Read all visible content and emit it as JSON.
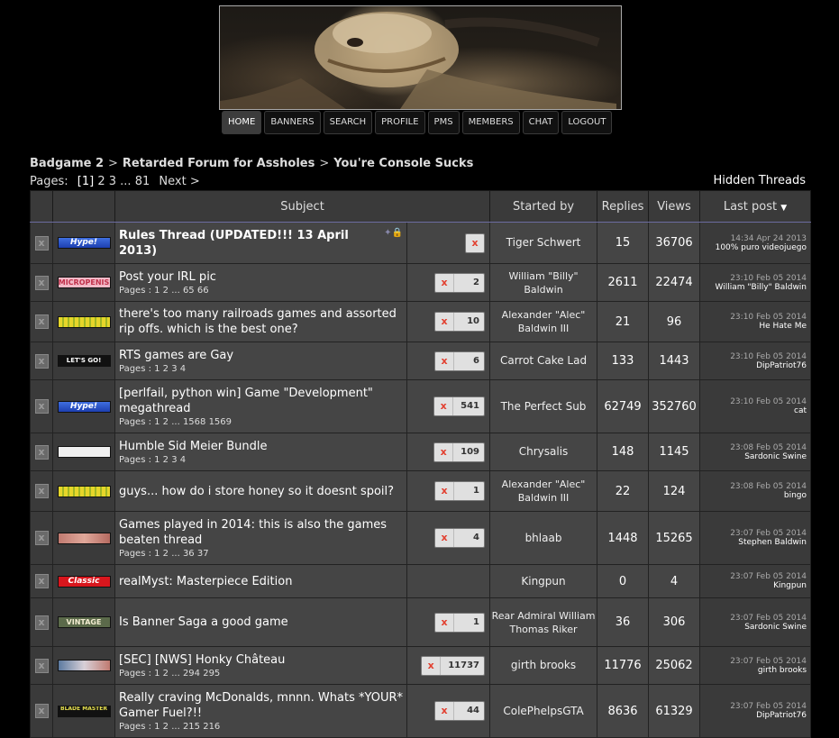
{
  "nav": {
    "items": [
      "Home",
      "Banners",
      "Search",
      "Profile",
      "PMs",
      "Members",
      "Chat",
      "Logout"
    ]
  },
  "breadcrumb": [
    "Badgame 2",
    "Retarded Forum for Assholes",
    "You're Console Sucks"
  ],
  "pages": {
    "label": "Pages:",
    "current": "[1]",
    "list": [
      "2",
      "3",
      "...",
      "81"
    ],
    "next": "Next >"
  },
  "hidden_threads": "Hidden Threads",
  "headers": {
    "subject": "Subject",
    "started_by": "Started by",
    "replies": "Replies",
    "views": "Views",
    "last_post": "Last post"
  },
  "threads": [
    {
      "icon": "Hype!",
      "icon_style": "hype",
      "title": "Rules Thread (UPDATED!!! 13 April 2013)",
      "bold": true,
      "pages": "",
      "unread": "",
      "author": "Tiger Schwert",
      "replies": "15",
      "views": "36706",
      "lp_time": "14:34 Apr 24 2013",
      "lp_user": "100% puro videojuego",
      "sticky": true
    },
    {
      "icon": "MICROPENIS",
      "icon_style": "pink",
      "title": "Post your IRL pic",
      "pages": "Pages : 1 2 ... 65 66",
      "unread": "2",
      "author": "William \"Billy\" Baldwin",
      "replies": "2611",
      "views": "22474",
      "lp_time": "23:10 Feb 05 2014",
      "lp_user": "William \"Billy\" Baldwin"
    },
    {
      "icon": "",
      "icon_style": "corn",
      "title": "there's too many railroads games and assorted rip offs. which is the best one?",
      "pages": "",
      "unread": "10",
      "author": "Alexander \"Alec\" Baldwin III",
      "replies": "21",
      "views": "96",
      "lp_time": "23:10 Feb 05 2014",
      "lp_user": "He Hate Me"
    },
    {
      "icon": "LET'S GO!",
      "icon_style": "letsgo",
      "title": "RTS games are Gay",
      "pages": "Pages : 1 2 3 4",
      "unread": "6",
      "author": "Carrot Cake Lad",
      "replies": "133",
      "views": "1443",
      "lp_time": "23:10 Feb 05 2014",
      "lp_user": "DipPatriot76"
    },
    {
      "icon": "Hype!",
      "icon_style": "hype",
      "title": "[perlfail, python win] Game \"Development\" megathread",
      "pages": "Pages : 1 2 ... 1568 1569",
      "unread": "541",
      "author": "The Perfect Sub",
      "replies": "62749",
      "views": "352760",
      "lp_time": "23:10 Feb 05 2014",
      "lp_user": "cat"
    },
    {
      "icon": "",
      "icon_style": "steam",
      "title": "Humble Sid Meier Bundle",
      "pages": "Pages : 1 2 3 4",
      "unread": "109",
      "author": "Chrysalis",
      "replies": "148",
      "views": "1145",
      "lp_time": "23:08 Feb 05 2014",
      "lp_user": "Sardonic Swine"
    },
    {
      "icon": "",
      "icon_style": "corn",
      "title": "guys... how do i store honey so it doesnt spoil?",
      "pages": "",
      "unread": "1",
      "author": "Alexander \"Alec\" Baldwin III",
      "replies": "22",
      "views": "124",
      "lp_time": "23:08 Feb 05 2014",
      "lp_user": "bingo"
    },
    {
      "icon": "",
      "icon_style": "face",
      "title": "Games played in 2014: this is also the games beaten thread",
      "pages": "Pages : 1 2 ... 36 37",
      "unread": "4",
      "author": "bhlaab",
      "replies": "1448",
      "views": "15265",
      "lp_time": "23:07 Feb 05 2014",
      "lp_user": "Stephen Baldwin"
    },
    {
      "icon": "Classic",
      "icon_style": "classic",
      "title": "realMyst: Masterpiece Edition",
      "pages": "",
      "unread": "",
      "author": "Kingpun",
      "replies": "0",
      "views": "4",
      "lp_time": "23:07 Feb 05 2014",
      "lp_user": "Kingpun"
    },
    {
      "icon": "VINTAGE",
      "icon_style": "vintage",
      "title": "Is Banner Saga a good game",
      "pages": "",
      "unread": "1",
      "author": "Rear Admiral William Thomas Riker",
      "replies": "36",
      "views": "306",
      "lp_time": "23:07 Feb 05 2014",
      "lp_user": "Sardonic Swine"
    },
    {
      "icon": "",
      "icon_style": "face2",
      "title": "[SEC] [NWS] Honky Château",
      "pages": "Pages : 1 2 ... 294 295",
      "unread": "11737",
      "author": "girth brooks",
      "replies": "11776",
      "views": "25062",
      "lp_time": "23:07 Feb 05 2014",
      "lp_user": "girth brooks"
    },
    {
      "icon": "BLADE MASTER",
      "icon_style": "blade",
      "title": "Really craving McDonalds, mnnn. Whats *YOUR* Gamer Fuel?!!",
      "pages": "Pages : 1 2 ... 215 216",
      "unread": "44",
      "author": "ColePhelpsGTA",
      "replies": "8636",
      "views": "61329",
      "lp_time": "23:07 Feb 05 2014",
      "lp_user": "DipPatriot76"
    }
  ],
  "colors": {
    "background": "#000000",
    "row": "#454545",
    "header": "#3a3a3a",
    "unread_x": "#e24030"
  }
}
